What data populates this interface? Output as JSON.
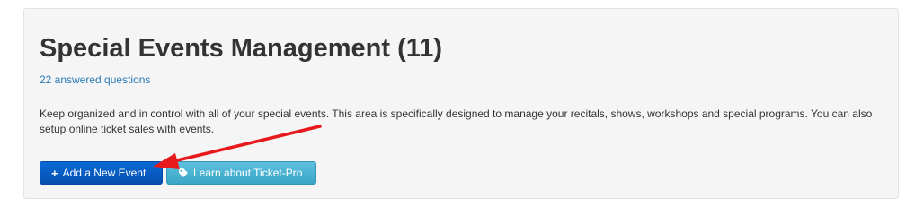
{
  "panel": {
    "title": "Special Events Management (11)",
    "answered_link": "22 answered questions",
    "description": "Keep organized and in control with all of your special events. This area is specifically designed to manage your recitals, shows, workshops and special programs. You can also setup online ticket sales with events."
  },
  "buttons": {
    "add_event": {
      "label": "Add a New Event",
      "icon": "plus-icon"
    },
    "learn_ticket_pro": {
      "label": "Learn about Ticket-Pro",
      "icon": "tag-icon"
    }
  },
  "annotation": {
    "type": "arrow",
    "color": "#e8191c",
    "points_to": "add-event-button"
  },
  "colors": {
    "primary_button": "#0a5fc7",
    "info_button": "#4bb3d4",
    "link": "#2a7ab5",
    "panel_bg": "#f5f5f5"
  }
}
